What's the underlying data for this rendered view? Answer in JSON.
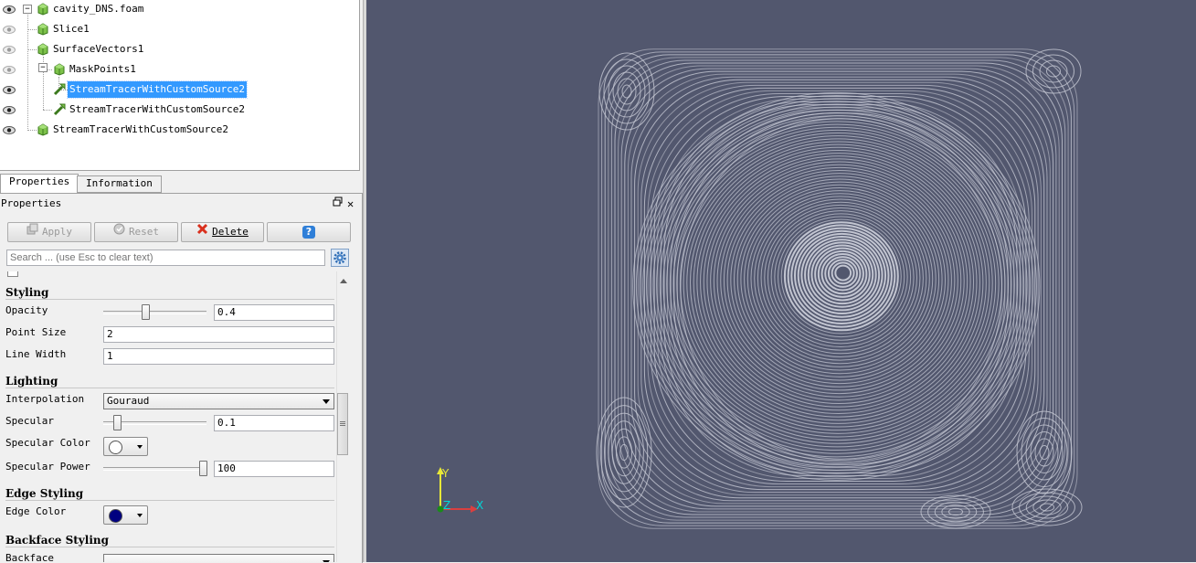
{
  "pipeline": {
    "items": [
      {
        "label": "cavity_DNS.foam",
        "visible": true
      },
      {
        "label": "Slice1",
        "visible": false
      },
      {
        "label": "SurfaceVectors1",
        "visible": false
      },
      {
        "label": "MaskPoints1",
        "visible": false
      },
      {
        "label": "StreamTracerWithCustomSource2",
        "visible": true,
        "selected": true
      },
      {
        "label": "StreamTracerWithCustomSource2",
        "visible": true
      },
      {
        "label": "StreamTracerWithCustomSource2",
        "visible": true
      }
    ]
  },
  "tabs": [
    {
      "label": "Properties",
      "active": true
    },
    {
      "label": "Information",
      "active": false
    }
  ],
  "properties_panel": {
    "title": "Properties",
    "float_icon": "float-window-icon",
    "close_icon": "close-icon",
    "buttons": {
      "apply": "Apply",
      "reset": "Reset",
      "delete": "Delete",
      "help": "?"
    },
    "search_placeholder": "Search ... (use Esc to clear text)",
    "sections": {
      "styling": {
        "title": "Styling",
        "opacity_label": "Opacity",
        "opacity_value": "0.4",
        "point_size_label": "Point Size",
        "point_size_value": "2",
        "line_width_label": "Line Width",
        "line_width_value": "1"
      },
      "lighting": {
        "title": "Lighting",
        "interpolation_label": "Interpolation",
        "interpolation_value": "Gouraud",
        "specular_label": "Specular",
        "specular_value": "0.1",
        "specular_color_label": "Specular Color",
        "specular_color": "#ffffff",
        "specular_power_label": "Specular Power",
        "specular_power_value": "100"
      },
      "edge_styling": {
        "title": "Edge Styling",
        "edge_color_label": "Edge Color",
        "edge_color": "#000080"
      },
      "backface_styling": {
        "title": "Backface Styling",
        "backface_label": "Backface"
      }
    }
  },
  "render_view": {
    "background_color": "#52576e",
    "streamline_color": "#c8cbd6",
    "axes": {
      "x": "X",
      "y": "Y",
      "z": "Z"
    }
  }
}
